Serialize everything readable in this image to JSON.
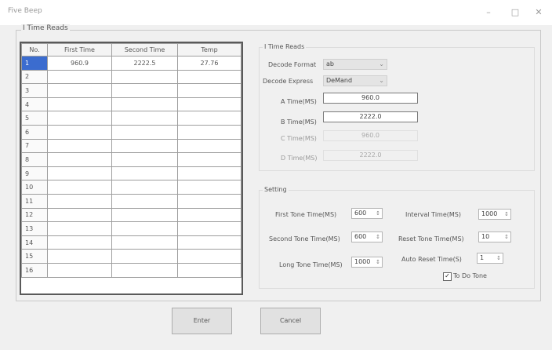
{
  "window": {
    "title": "Five Beep"
  },
  "frame": {
    "label": "I Time Reads"
  },
  "table": {
    "headers": [
      "No.",
      "First Time",
      "Second Time",
      "Temp"
    ],
    "rows": [
      [
        "1",
        "960.9",
        "2222.5",
        "27.76"
      ],
      [
        "2",
        "",
        "",
        ""
      ],
      [
        "3",
        "",
        "",
        ""
      ],
      [
        "4",
        "",
        "",
        ""
      ],
      [
        "5",
        "",
        "",
        ""
      ],
      [
        "6",
        "",
        "",
        ""
      ],
      [
        "7",
        "",
        "",
        ""
      ],
      [
        "8",
        "",
        "",
        ""
      ],
      [
        "9",
        "",
        "",
        ""
      ],
      [
        "10",
        "",
        "",
        ""
      ],
      [
        "11",
        "",
        "",
        ""
      ],
      [
        "12",
        "",
        "",
        ""
      ],
      [
        "13",
        "",
        "",
        ""
      ],
      [
        "14",
        "",
        "",
        ""
      ],
      [
        "15",
        "",
        "",
        ""
      ],
      [
        "16",
        "",
        "",
        ""
      ]
    ]
  },
  "time_panel": {
    "label": "I Time Reads",
    "decode_format_label": "Decode Format",
    "decode_format_value": "ab",
    "decode_express_label": "Decode Express",
    "decode_express_value": "DeMand",
    "a_time_label": "A Time(MS)",
    "a_time_value": "960.0",
    "b_time_label": "B Time(MS)",
    "b_time_value": "2222.0",
    "c_time_label": "C Time(MS)",
    "c_time_value": "960.0",
    "d_time_label": "D Time(MS)",
    "d_time_value": "2222.0"
  },
  "settings": {
    "label": "Setting",
    "first_label": "First Tone Time(MS)",
    "first_value": "600",
    "second_label": "Second Tone Time(MS)",
    "second_value": "600",
    "long_label": "Long Tone Time(MS)",
    "long_value": "1000",
    "interval_label": "Interval Time(MS)",
    "interval_value": "1000",
    "reset_label": "Reset Tone Time(MS)",
    "reset_value": "10",
    "auto_label": "Auto Reset Time(S)",
    "auto_value": "1",
    "checkbox_label": "To Do Tone",
    "checkbox_checked": true
  },
  "buttons": {
    "enter": "Enter",
    "cancel": "Cancel"
  },
  "icons": {
    "minimize": "minimize-icon",
    "maximize": "maximize-icon",
    "close": "close-icon",
    "dropdown": "chevron-down-icon",
    "spin": "spin-arrows-icon",
    "check": "checkmark-icon"
  },
  "colors": {
    "selected_row": "#3b6ccf",
    "window_bg": "#f0f0f0"
  }
}
